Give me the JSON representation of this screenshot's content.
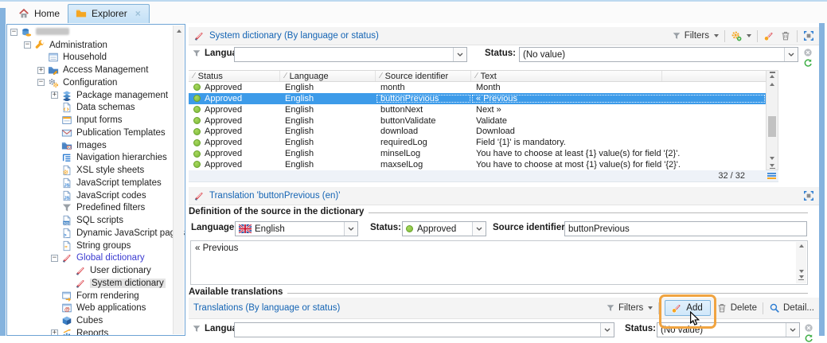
{
  "tabs": {
    "home": {
      "label": "Home"
    },
    "explorer": {
      "label": "Explorer",
      "active": true
    }
  },
  "tree": {
    "items": [
      {
        "label": "",
        "icon": "database",
        "level": 0,
        "expander": "minus",
        "redacted": true
      },
      {
        "label": "Administration",
        "icon": "wrench",
        "level": 1,
        "expander": "minus"
      },
      {
        "label": "Household",
        "icon": "form",
        "level": 2,
        "expander": "none"
      },
      {
        "label": "Access Management",
        "icon": "folder-edit",
        "level": 2,
        "expander": "plus"
      },
      {
        "label": "Configuration",
        "icon": "gears",
        "level": 2,
        "expander": "minus"
      },
      {
        "label": "Package management",
        "icon": "package",
        "level": 3,
        "expander": "plus"
      },
      {
        "label": "Data schemas",
        "icon": "doc-code",
        "level": 3,
        "expander": "none"
      },
      {
        "label": "Input forms",
        "icon": "window",
        "level": 3,
        "expander": "none"
      },
      {
        "label": "Publication Templates",
        "icon": "mail",
        "level": 3,
        "expander": "none"
      },
      {
        "label": "Images",
        "icon": "folder-image",
        "level": 3,
        "expander": "none"
      },
      {
        "label": "Navigation hierarchies",
        "icon": "list",
        "level": 3,
        "expander": "none"
      },
      {
        "label": "XSL style sheets",
        "icon": "doc-gear",
        "level": 3,
        "expander": "none"
      },
      {
        "label": "JavaScript templates",
        "icon": "doc-js",
        "level": 3,
        "expander": "none"
      },
      {
        "label": "JavaScript codes",
        "icon": "doc-js",
        "level": 3,
        "expander": "none"
      },
      {
        "label": "Predefined filters",
        "icon": "funnel",
        "level": 3,
        "expander": "none"
      },
      {
        "label": "SQL scripts",
        "icon": "doc-sql",
        "level": 3,
        "expander": "none"
      },
      {
        "label": "Dynamic JavaScript pages",
        "icon": "doc-terminal",
        "level": 3,
        "expander": "none"
      },
      {
        "label": "String groups",
        "icon": "doc-string",
        "level": 3,
        "expander": "none"
      },
      {
        "label": "Global dictionary",
        "icon": "book",
        "level": 3,
        "expander": "minus",
        "link": true
      },
      {
        "label": "User dictionary",
        "icon": "book",
        "level": 4,
        "expander": "none"
      },
      {
        "label": "System dictionary",
        "icon": "book",
        "level": 4,
        "expander": "none",
        "selected": true
      },
      {
        "label": "Form rendering",
        "icon": "window-arrow",
        "level": 3,
        "expander": "none"
      },
      {
        "label": "Web applications",
        "icon": "window-at",
        "level": 3,
        "expander": "none"
      },
      {
        "label": "Cubes",
        "icon": "cube",
        "level": 3,
        "expander": "none"
      },
      {
        "label": "Reports",
        "icon": "chart",
        "level": 3,
        "expander": "plus"
      }
    ]
  },
  "panel1": {
    "title": "System dictionary (By language or status)",
    "toolbar": {
      "filters_label": "Filters"
    },
    "filter": {
      "language_label": "Language:",
      "language_value": "",
      "status_label": "Status:",
      "status_value": "(No value)"
    },
    "table": {
      "columns": [
        "Status",
        "Language",
        "Source identifier",
        "Text"
      ],
      "rows": [
        {
          "status": "Approved",
          "language": "English",
          "source": "month",
          "text": "Month"
        },
        {
          "status": "Approved",
          "language": "English",
          "source": "buttonPrevious",
          "text": "« Previous",
          "selected": true
        },
        {
          "status": "Approved",
          "language": "English",
          "source": "buttonNext",
          "text": "Next »"
        },
        {
          "status": "Approved",
          "language": "English",
          "source": "buttonValidate",
          "text": "Validate"
        },
        {
          "status": "Approved",
          "language": "English",
          "source": "download",
          "text": "Download"
        },
        {
          "status": "Approved",
          "language": "English",
          "source": "requiredLog",
          "text": "Field '{1}' is mandatory."
        },
        {
          "status": "Approved",
          "language": "English",
          "source": "minselLog",
          "text": "You have to choose at least {1} value(s) for field '{2}'."
        },
        {
          "status": "Approved",
          "language": "English",
          "source": "maxselLog",
          "text": "You have to choose at most {1} value(s) for field '{2}'."
        }
      ],
      "count": "32 / 32"
    }
  },
  "panel2": {
    "title": "Translation 'buttonPrevious (en)'",
    "legend": "Definition of the source in the dictionary",
    "language_label": "Language:",
    "language_value": "English",
    "status_label": "Status:",
    "status_value": "Approved",
    "source_label": "Source identifier:",
    "source_value": "buttonPrevious",
    "text_value": "« Previous",
    "available_legend": "Available translations"
  },
  "panel3": {
    "title": "Translations (By language or status)",
    "toolbar": {
      "filters_label": "Filters",
      "add_label": "Add",
      "delete_label": "Delete",
      "detail_label": "Detail..."
    },
    "filter": {
      "language_label": "Language:",
      "language_value": "",
      "status_label": "Status:",
      "status_value": "(No value)"
    }
  },
  "colors": {
    "accent_blue": "#1464b4",
    "selection_blue": "#3d9be9",
    "status_green": "#8dc63f",
    "annotation_orange": "#f0a441"
  }
}
